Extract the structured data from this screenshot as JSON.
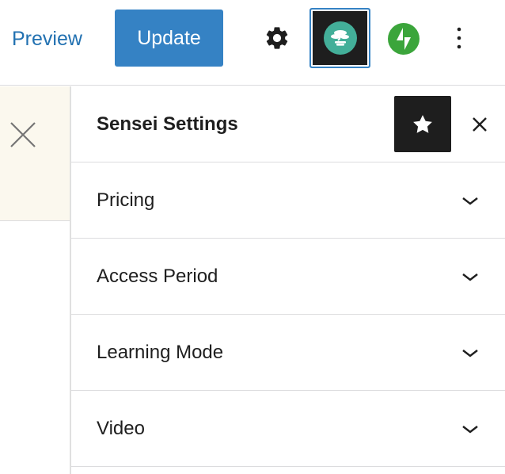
{
  "header": {
    "preview_label": "Preview",
    "update_label": "Update",
    "icons": {
      "settings": "gear-icon",
      "sensei": "sensei-bonsai-icon",
      "jetpack": "jetpack-bolt-icon",
      "more": "more-vertical-icon"
    }
  },
  "sidebar": {
    "title": "Sensei Settings",
    "panels": [
      {
        "label": "Pricing"
      },
      {
        "label": "Access Period"
      },
      {
        "label": "Learning Mode"
      },
      {
        "label": "Video"
      }
    ]
  },
  "colors": {
    "accent": "#3582c4",
    "link": "#2271b1",
    "sensei_green": "#43af99",
    "jetpack_green": "#3ba53b",
    "dark": "#1e1e1e",
    "left_panel_bg": "#fbf8ee"
  }
}
